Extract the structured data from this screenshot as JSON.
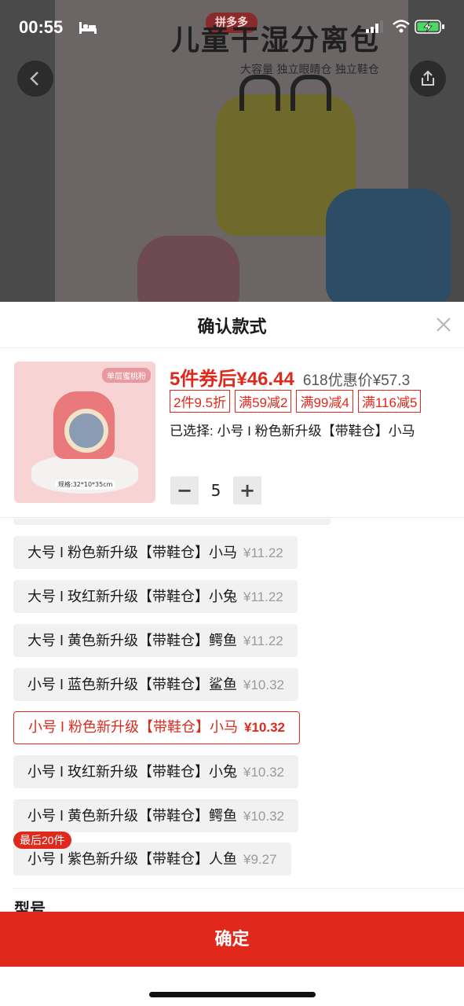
{
  "status_bar": {
    "time": "00:55"
  },
  "background": {
    "badge": "拼多多",
    "title": "儿童干湿分离包",
    "subtitle": "大容量 独立眼睛仓 独立鞋仓"
  },
  "sheet": {
    "title": "确认款式",
    "product": {
      "thumb_tag": "单层蜜桃粉",
      "thumb_spec": "规格:32*10*35cm",
      "price_prefix": "5件券后",
      "price_currency": "¥",
      "price_int": "46",
      "price_dec": ".44",
      "original_price": "618优惠价¥57.3",
      "coupons": [
        "2件9.5折",
        "满59减2",
        "满99减4",
        "满116减5"
      ],
      "selected_text": "已选择: 小号 I 粉色新升级【带鞋仓】小马"
    },
    "quantity": {
      "minus": "−",
      "value": "5",
      "plus": "+"
    },
    "options": [
      {
        "label": "大号 I 粉色新升级【带鞋仓】小马",
        "price": "¥11.22",
        "selected": false
      },
      {
        "label": "大号 I 玫红新升级【带鞋仓】小兔",
        "price": "¥11.22",
        "selected": false
      },
      {
        "label": "大号 I 黄色新升级【带鞋仓】鳄鱼",
        "price": "¥11.22",
        "selected": false
      },
      {
        "label": "小号 I 蓝色新升级【带鞋仓】鲨鱼",
        "price": "¥10.32",
        "selected": false
      },
      {
        "label": "小号 I 粉色新升级【带鞋仓】小马",
        "price": "¥10.32",
        "selected": true
      },
      {
        "label": "小号 I 玫红新升级【带鞋仓】小兔",
        "price": "¥10.32",
        "selected": false
      },
      {
        "label": "小号 I 黄色新升级【带鞋仓】鳄鱼",
        "price": "¥10.32",
        "selected": false
      },
      {
        "label": "小号 I 紫色新升级【带鞋仓】人鱼",
        "price": "¥9.27",
        "selected": false
      }
    ],
    "last_stock_badge": "最后20件",
    "model_label": "型号",
    "confirm_button": "确定"
  },
  "colors": {
    "accent": "#e0291c",
    "option_bg": "#f1f1f1"
  }
}
